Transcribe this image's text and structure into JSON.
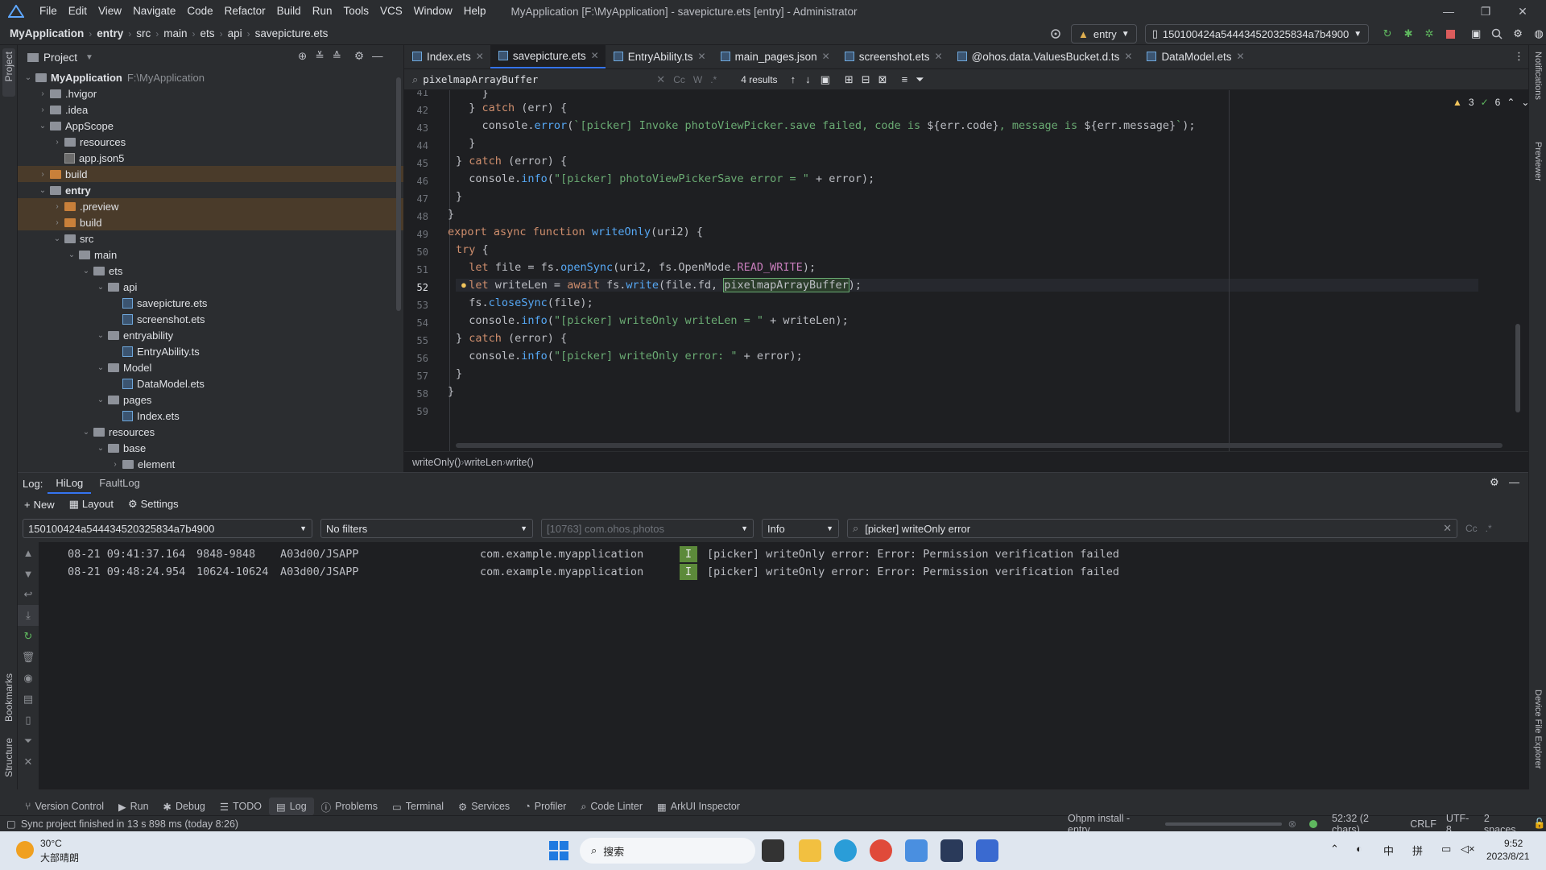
{
  "window": {
    "title": "MyApplication [F:\\MyApplication] - savepicture.ets [entry] - Administrator",
    "menu": [
      "File",
      "Edit",
      "View",
      "Navigate",
      "Code",
      "Refactor",
      "Build",
      "Run",
      "Tools",
      "VCS",
      "Window",
      "Help"
    ]
  },
  "navbar": {
    "breadcrumbs": [
      "MyApplication",
      "entry",
      "src",
      "main",
      "ets",
      "api",
      "savepicture.ets"
    ],
    "run_config": "entry",
    "device": "150100424a544434520325834a7b4900"
  },
  "project_panel": {
    "title": "Project",
    "tree": [
      {
        "label": "MyApplication",
        "hint": "F:\\MyApplication",
        "depth": 0,
        "open": true,
        "type": "folder",
        "bold": true
      },
      {
        "label": ".hvigor",
        "depth": 1,
        "open": false,
        "type": "folder"
      },
      {
        "label": ".idea",
        "depth": 1,
        "open": false,
        "type": "folder"
      },
      {
        "label": "AppScope",
        "depth": 1,
        "open": true,
        "type": "folder"
      },
      {
        "label": "resources",
        "depth": 2,
        "open": false,
        "type": "folder"
      },
      {
        "label": "app.json5",
        "depth": 2,
        "type": "json"
      },
      {
        "label": "build",
        "depth": 1,
        "open": false,
        "type": "folder-orange",
        "hl": true
      },
      {
        "label": "entry",
        "depth": 1,
        "open": true,
        "type": "folder",
        "bold": true
      },
      {
        "label": ".preview",
        "depth": 2,
        "open": false,
        "type": "folder-orange",
        "hl": true
      },
      {
        "label": "build",
        "depth": 2,
        "open": false,
        "type": "folder-orange",
        "hl": true
      },
      {
        "label": "src",
        "depth": 2,
        "open": true,
        "type": "folder"
      },
      {
        "label": "main",
        "depth": 3,
        "open": true,
        "type": "folder"
      },
      {
        "label": "ets",
        "depth": 4,
        "open": true,
        "type": "folder"
      },
      {
        "label": "api",
        "depth": 5,
        "open": true,
        "type": "folder"
      },
      {
        "label": "savepicture.ets",
        "depth": 6,
        "type": "file"
      },
      {
        "label": "screenshot.ets",
        "depth": 6,
        "type": "file"
      },
      {
        "label": "entryability",
        "depth": 5,
        "open": true,
        "type": "folder"
      },
      {
        "label": "EntryAbility.ts",
        "depth": 6,
        "type": "file"
      },
      {
        "label": "Model",
        "depth": 5,
        "open": true,
        "type": "folder"
      },
      {
        "label": "DataModel.ets",
        "depth": 6,
        "type": "file"
      },
      {
        "label": "pages",
        "depth": 5,
        "open": true,
        "type": "folder"
      },
      {
        "label": "Index.ets",
        "depth": 6,
        "type": "file"
      },
      {
        "label": "resources",
        "depth": 4,
        "open": true,
        "type": "folder"
      },
      {
        "label": "base",
        "depth": 5,
        "open": true,
        "type": "folder"
      },
      {
        "label": "element",
        "depth": 6,
        "open": false,
        "type": "folder"
      }
    ]
  },
  "editor": {
    "tabs": [
      {
        "label": "Index.ets",
        "active": false
      },
      {
        "label": "savepicture.ets",
        "active": true
      },
      {
        "label": "EntryAbility.ts",
        "active": false
      },
      {
        "label": "main_pages.json",
        "active": false
      },
      {
        "label": "screenshot.ets",
        "active": false
      },
      {
        "label": "@ohos.data.ValuesBucket.d.ts",
        "active": false
      },
      {
        "label": "DataModel.ets",
        "active": false
      }
    ],
    "find": {
      "query": "pixelmapArrayBuffer",
      "results": "4 results"
    },
    "inspections": {
      "warnings": "3",
      "ok": "6"
    },
    "line_numbers": [
      "41",
      "42",
      "43",
      "44",
      "45",
      "46",
      "47",
      "48",
      "49",
      "50",
      "51",
      "52",
      "53",
      "54",
      "55",
      "56",
      "57",
      "58",
      "59"
    ],
    "code_crumbs": [
      "writeOnly()",
      "writeLen",
      "write()"
    ]
  },
  "log": {
    "label": "Log:",
    "tabs": [
      "HiLog",
      "FaultLog"
    ],
    "toolbar": [
      "New",
      "Layout",
      "Settings"
    ],
    "device_filter": "150100424a544434520325834a7b4900",
    "filter": "No filters",
    "process_placeholder": "[10763] com.ohos.photos",
    "level": "Info",
    "search": "[picker] writeOnly error",
    "lines": [
      {
        "time": "08-21 09:41:37.164",
        "pid": "9848-9848",
        "tag": "A03d00/JSAPP",
        "pkg": "com.example.myapplication",
        "level": "I",
        "msg": "[picker] writeOnly error: Error: Permission verification failed"
      },
      {
        "time": "08-21 09:48:24.954",
        "pid": "10624-10624",
        "tag": "A03d00/JSAPP",
        "pkg": "com.example.myapplication",
        "level": "I",
        "msg": "[picker] writeOnly error: Error: Permission verification failed"
      }
    ]
  },
  "bottom_tools": [
    "Version Control",
    "Run",
    "Debug",
    "TODO",
    "Log",
    "Problems",
    "Terminal",
    "Services",
    "Profiler",
    "Code Linter",
    "ArkUI Inspector"
  ],
  "status": {
    "message": "Sync project finished in 13 s 898 ms (today 8:26)",
    "task": "Ohpm install - entry",
    "position": "52:32 (2 chars)",
    "line_sep": "CRLF",
    "encoding": "UTF-8",
    "indent": "2 spaces"
  },
  "side_labels": {
    "project": "Project",
    "bookmarks": "Bookmarks",
    "structure": "Structure",
    "notifications": "Notifications",
    "previewer": "Previewer",
    "device_explorer": "Device File Explorer"
  },
  "taskbar": {
    "temp": "30°C",
    "weather": "大部晴朗",
    "search": "搜索",
    "time": "9:52",
    "date": "2023/8/21",
    "ime1": "中",
    "ime2": "拼"
  }
}
